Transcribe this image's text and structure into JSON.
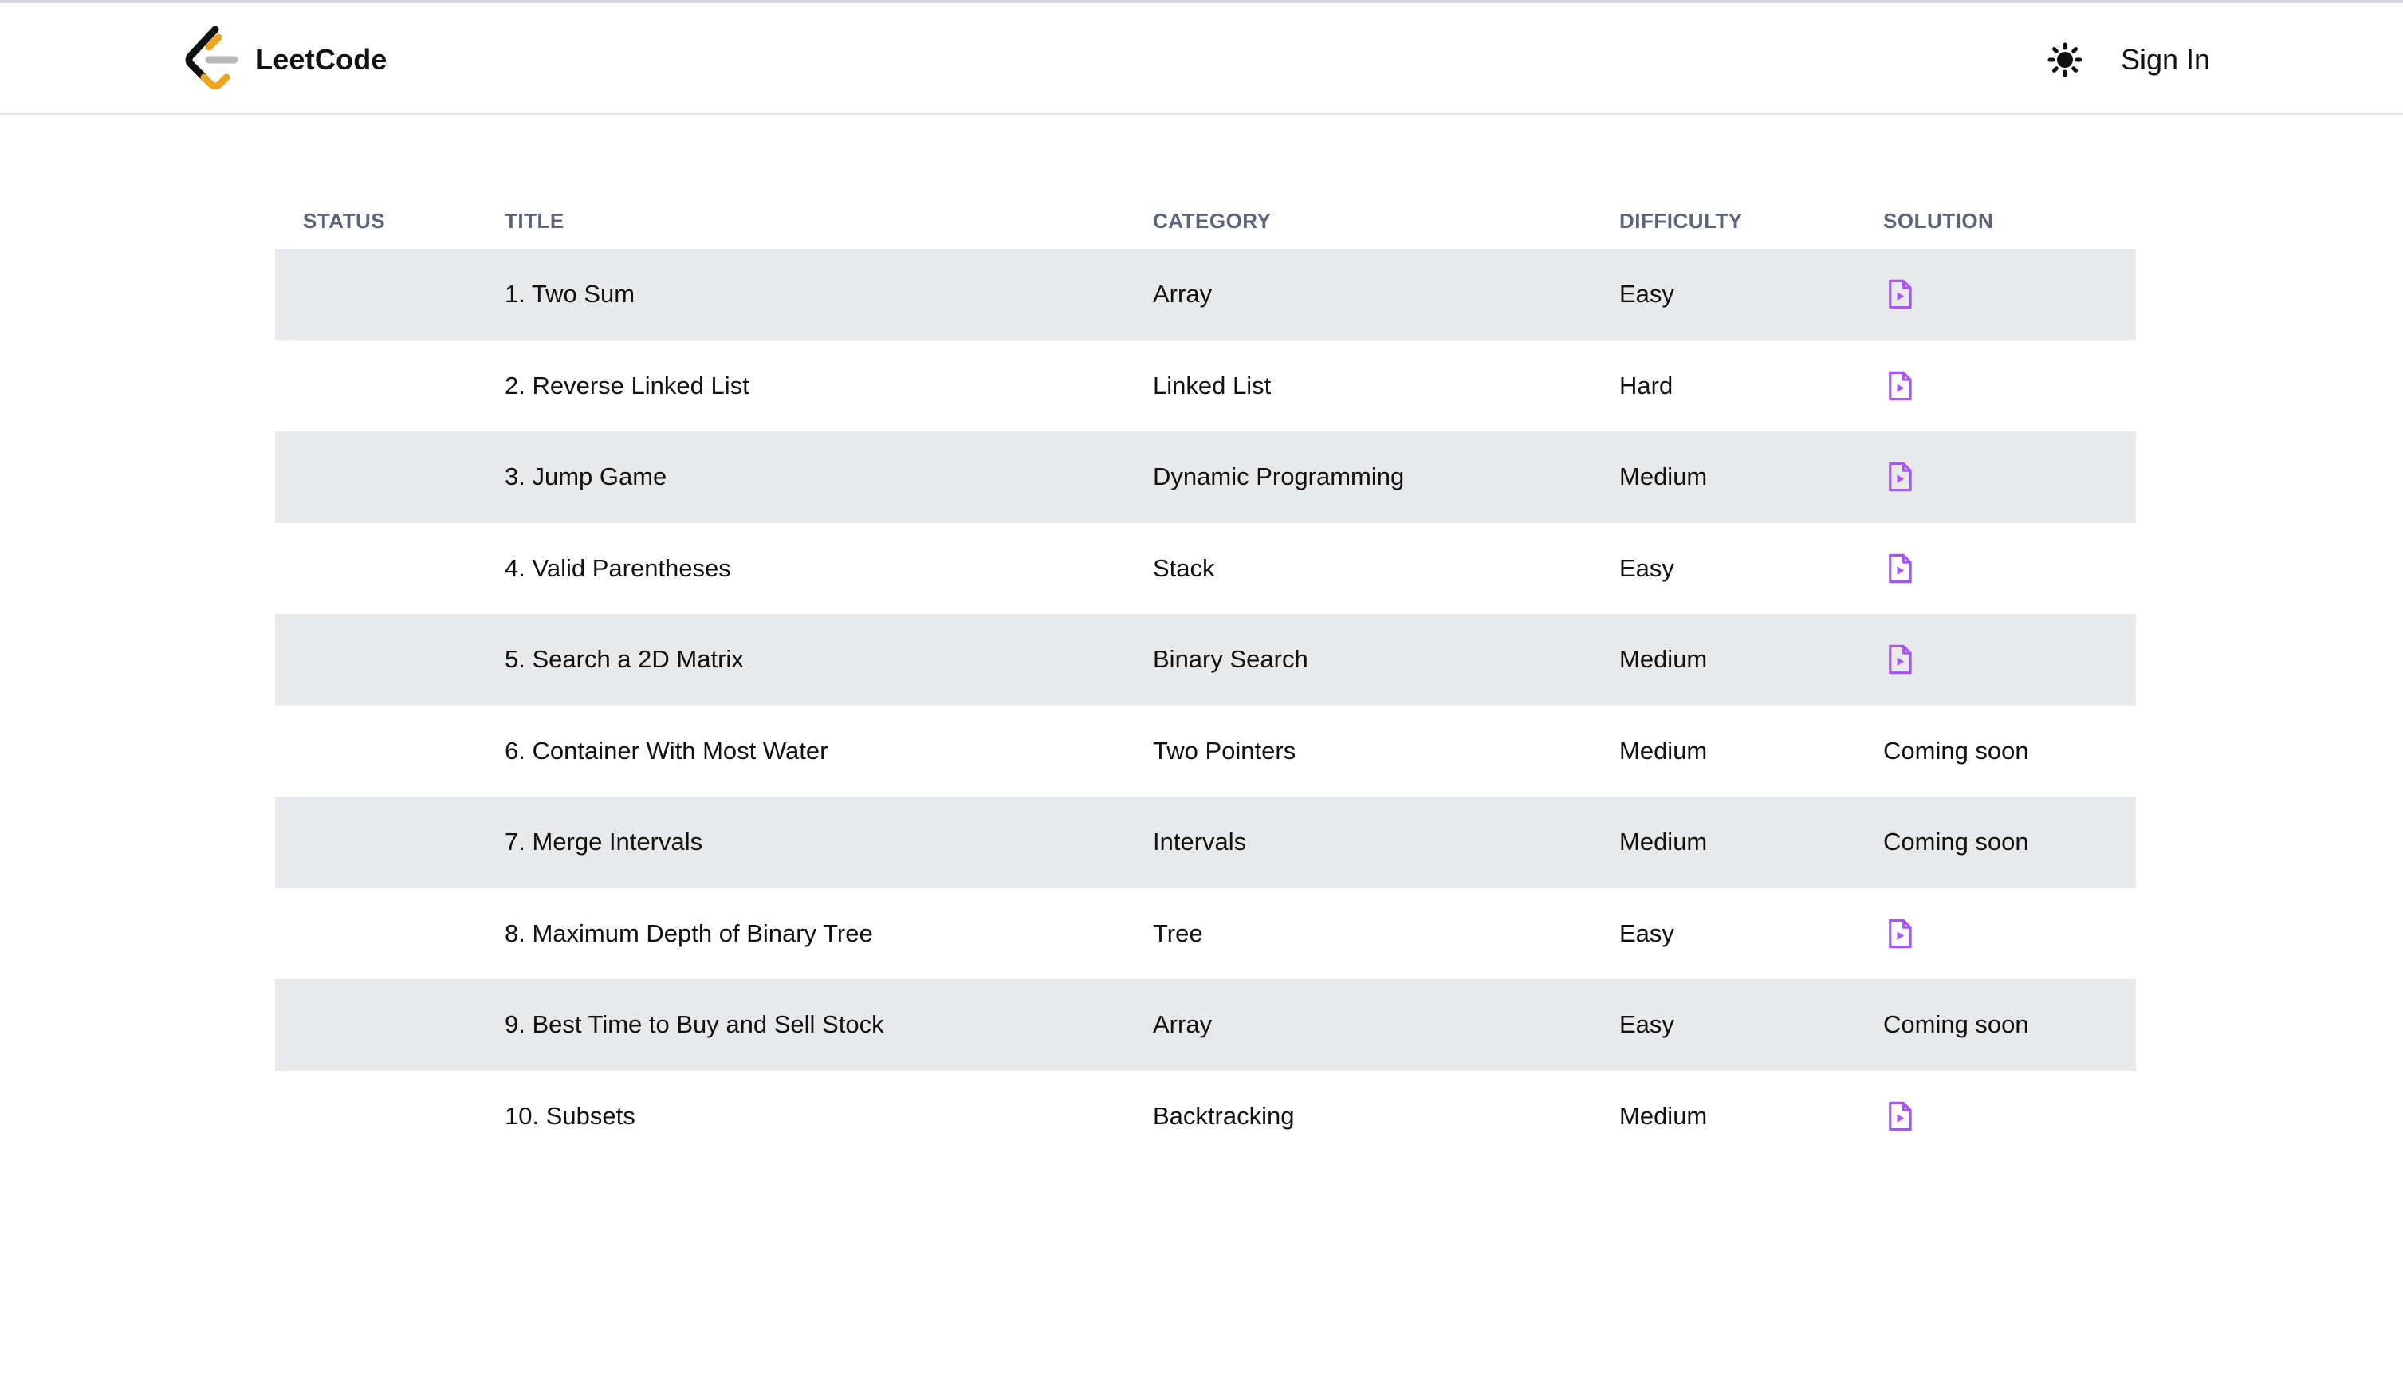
{
  "brand": {
    "name": "LeetCode"
  },
  "nav": {
    "sign_in": "Sign In",
    "theme_icon": "sun-icon"
  },
  "table": {
    "headers": {
      "status": "STATUS",
      "title": "TITLE",
      "category": "CATEGORY",
      "difficulty": "DIFFICULTY",
      "solution": "SOLUTION"
    },
    "rows": [
      {
        "title": "1. Two Sum",
        "category": "Array",
        "difficulty": "Easy",
        "solution": "video-icon"
      },
      {
        "title": "2. Reverse Linked List",
        "category": "Linked List",
        "difficulty": "Hard",
        "solution": "video-icon"
      },
      {
        "title": "3. Jump Game",
        "category": "Dynamic Programming",
        "difficulty": "Medium",
        "solution": "video-icon"
      },
      {
        "title": "4. Valid Parentheses",
        "category": "Stack",
        "difficulty": "Easy",
        "solution": "video-icon"
      },
      {
        "title": "5. Search a 2D Matrix",
        "category": "Binary Search",
        "difficulty": "Medium",
        "solution": "video-icon"
      },
      {
        "title": "6. Container With Most Water",
        "category": "Two Pointers",
        "difficulty": "Medium",
        "solution": "Coming soon"
      },
      {
        "title": "7. Merge Intervals",
        "category": "Intervals",
        "difficulty": "Medium",
        "solution": "Coming soon"
      },
      {
        "title": "8. Maximum Depth of Binary Tree",
        "category": "Tree",
        "difficulty": "Easy",
        "solution": "video-icon"
      },
      {
        "title": "9. Best Time to Buy and Sell Stock",
        "category": "Array",
        "difficulty": "Easy",
        "solution": "Coming soon"
      },
      {
        "title": "10. Subsets",
        "category": "Backtracking",
        "difficulty": "Medium",
        "solution": "video-icon"
      }
    ]
  },
  "colors": {
    "easy": "#2cb59c",
    "medium": "#e3ac2e",
    "hard": "#e0403b",
    "solution_icon": "#a855f7",
    "row_stripe": "#e8e9eb",
    "header_text": "#5b6478"
  }
}
